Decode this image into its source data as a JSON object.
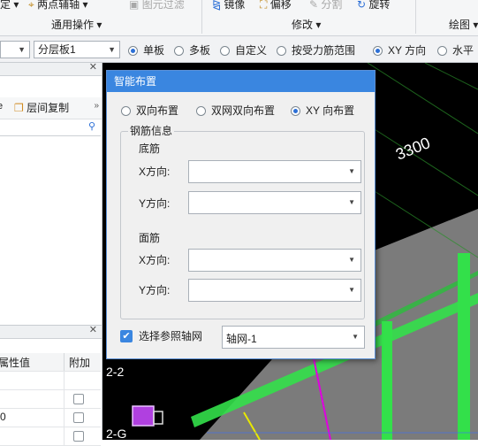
{
  "ribbon": {
    "items": {
      "ding": "定 ▾",
      "two_point_axis": "两点辅轴 ▾",
      "element_filter": "图元过滤",
      "mirror": "镜像",
      "offset": "偏移",
      "split": "分割",
      "rotate": "旋转"
    },
    "groups": {
      "general": "通用操作 ▾",
      "modify": "修改 ▾",
      "draw": "绘图 ▾"
    }
  },
  "toolbar2": {
    "layer_combo": "分层板1",
    "options": [
      "单板",
      "多板",
      "自定义",
      "按受力筋范围",
      "XY 方向",
      "水平"
    ],
    "selected_left": "单板",
    "selected_right": "XY 方向"
  },
  "left_panel": {
    "copy_floor": "层间复制",
    "grid_headers": [
      "属性值",
      "附加"
    ],
    "grid_values": [
      "",
      "",
      "0",
      ""
    ]
  },
  "canvas": {
    "dimension_label": "3300",
    "axis_labels": [
      "2-2",
      "2-G"
    ]
  },
  "dialog": {
    "title": "智能布置",
    "layout_options": [
      "双向布置",
      "双网双向布置",
      "XY 向布置"
    ],
    "selected_layout": "XY 向布置",
    "group_title": "钢筋信息",
    "bottom_bar": {
      "heading": "底筋",
      "x_label": "X方向:",
      "y_label": "Y方向:",
      "x_value": "",
      "y_value": ""
    },
    "top_bar": {
      "heading": "面筋",
      "x_label": "X方向:",
      "y_label": "Y方向:",
      "x_value": "",
      "y_value": ""
    },
    "ref_axis_checkbox": "选择参照轴网",
    "ref_axis_checked": true,
    "ref_axis_value": "轴网-1"
  },
  "colors": {
    "dialog_title_bg": "#3a86e0",
    "canvas_bg": "#000000",
    "beam_green": "#33e04a",
    "slab_gray": "#808080",
    "magenta": "#e000e0",
    "yellow": "#e8e800"
  }
}
